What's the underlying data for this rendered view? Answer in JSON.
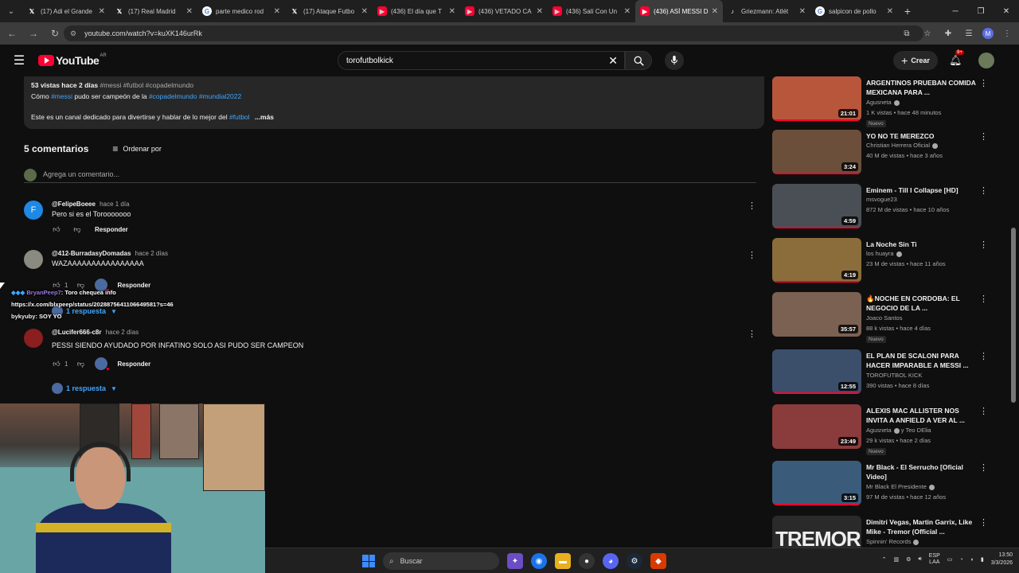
{
  "browser": {
    "tabs": [
      {
        "icon": "x-icon",
        "label": "(17) Adi el Grande",
        "active": false
      },
      {
        "icon": "x-icon",
        "label": "(17) Real Madrid",
        "active": false
      },
      {
        "icon": "google-icon",
        "label": "parte medico rod",
        "active": false
      },
      {
        "icon": "x-icon",
        "label": "(17) Ataque Futbo",
        "active": false
      },
      {
        "icon": "youtube-icon",
        "label": "(436) El día que T",
        "active": false
      },
      {
        "icon": "youtube-icon",
        "label": "(436) VETADO CA",
        "active": false
      },
      {
        "icon": "youtube-icon",
        "label": "(436) Salí Con Un",
        "active": false
      },
      {
        "icon": "youtube-icon",
        "label": "(436) ASÍ MESSI D",
        "active": true
      },
      {
        "icon": "tiktok-icon",
        "label": "Griezmann: Atlét",
        "active": false
      },
      {
        "icon": "google-icon",
        "label": "salpicon de pollo",
        "active": false
      }
    ],
    "url": "youtube.com/watch?v=kuXK146urRk",
    "profile_initial": "M"
  },
  "masthead": {
    "logo_text": "YouTube",
    "country_code": "AR",
    "search_value": "torofutbolkick",
    "create_label": "Crear",
    "notifications_badge": "9+"
  },
  "description": {
    "stats": "53 vistas  hace 2 días",
    "tags": "#messi #futbol #copadelmundo",
    "line2_pre": "Cómo",
    "line2_tag1": "#messi",
    "line2_mid": "pudo ser campeón de la",
    "line2_tag2": "#copadelmundo",
    "line2_tag3": "#mundial2022",
    "line3_pre": "Este es un canal dedicado para divertirse y hablar de lo mejor del",
    "line3_tag": "#futbol",
    "more_label": "...más"
  },
  "comments": {
    "count_label": "5 comentarios",
    "sort_label": "Ordenar por",
    "add_placeholder": "Agrega un comentario...",
    "items": [
      {
        "handle": "@FelipeBoeee",
        "time": "hace 1 día",
        "text": "Pero si es el Torooooooo",
        "likes": "",
        "reply_label": "Responder",
        "avatar_letter": "F",
        "avatar_color": "#1e88e5"
      },
      {
        "handle": "@412-BurradasyDomadas",
        "time": "hace 2 días",
        "text": "WAZAAAAAAAAAAAAAAAA",
        "likes": "1",
        "reply_label": "Responder",
        "avatar_letter": "",
        "avatar_color": "#8a8a80",
        "replies_label": "1 respuesta"
      },
      {
        "handle": "@Lucifer666-c8r",
        "time": "hace 2 días",
        "text": "PESSI SIENDO AYUDADO POR INFATINO SOLO ASI PUDO SER CAMPEON",
        "likes": "1",
        "reply_label": "Responder",
        "avatar_letter": "",
        "avatar_color": "#8b1e1e",
        "replies_label": "1 respuesta"
      }
    ]
  },
  "chat_overlay": {
    "line1_user": "BryanPeep7",
    "line1_text": ": Toro chequea info",
    "line2_text": "https://x.com/blxpeep/status/2028875641106649581?s=46",
    "line3_user": "bykyuby",
    "line3_text": ": SOY YO"
  },
  "sidebar": {
    "videos": [
      {
        "title": "ARGENTINOS PRUEBAN COMIDA MEXICANA PARA ...",
        "channel": "Agusneta",
        "verified": true,
        "stats": "1 K vistas • hace 48 minutos",
        "duration": "21:01",
        "badge": "Nuevo",
        "progress": true,
        "thumb_color": "#b8563b"
      },
      {
        "title": "YO NO TE MEREZCO",
        "channel": "Christian Herrera Oficial",
        "verified": true,
        "stats": "40 M de vistas • hace 3 años",
        "duration": "3:24",
        "badge": "",
        "progress": true,
        "thumb_color": "#6b4f3a"
      },
      {
        "title": "Eminem - Till I Collapse [HD]",
        "channel": "msvogue23",
        "verified": false,
        "stats": "872 M de vistas • hace 10 años",
        "duration": "4:59",
        "badge": "",
        "progress": true,
        "thumb_color": "#4a4f55"
      },
      {
        "title": "La Noche Sin Ti",
        "channel": "los huayra",
        "verified": true,
        "stats": "23 M de vistas • hace 11 años",
        "duration": "4:19",
        "badge": "",
        "progress": true,
        "thumb_color": "#8a6d3b"
      },
      {
        "title": "🔥NOCHE EN CORDOBA: EL NEGOCIO DE LA ...",
        "channel": "Joaco Santos",
        "verified": false,
        "stats": "88 k vistas • hace 4 días",
        "duration": "35:57",
        "badge": "Nuevo",
        "progress": false,
        "thumb_color": "#7a6152"
      },
      {
        "title": "EL PLAN DE SCALONI PARA HACER IMPARABLE A MESSI ...",
        "channel": "TOROFUTBOL KICK",
        "verified": false,
        "stats": "390 vistas • hace 8 días",
        "duration": "12:55",
        "badge": "",
        "progress": true,
        "thumb_color": "#3b4f6b"
      },
      {
        "title": "ALEXIS MAC ALLISTER NOS INVITA A ANFIELD A VER AL ...",
        "channel": "Agusneta",
        "channel_suffix": "y Teo DElia",
        "verified": true,
        "stats": "29 k vistas • hace 2 días",
        "duration": "23:49",
        "badge": "Nuevo",
        "progress": false,
        "thumb_color": "#8a3b3b"
      },
      {
        "title": "Mr Black - El Serrucho [Oficial Video]",
        "channel": "Mr Black El Presidente",
        "verified": true,
        "stats": "97 M de vistas • hace 12 años",
        "duration": "3:15",
        "badge": "",
        "progress": true,
        "thumb_color": "#3b5b7a"
      },
      {
        "title": "Dimitri Vegas, Martin Garrix, Like Mike - Tremor (Official ...",
        "channel": "Spinnin' Records",
        "verified": true,
        "stats": "",
        "duration": "",
        "badge": "",
        "progress": false,
        "thumb_color": "#2a2a2a",
        "thumb_text": "TREMOR"
      }
    ]
  },
  "taskbar": {
    "search_placeholder": "Buscar",
    "lang_line1": "ESP",
    "lang_line2": "LAA",
    "time": "13:50",
    "date": "3/3/2026"
  }
}
